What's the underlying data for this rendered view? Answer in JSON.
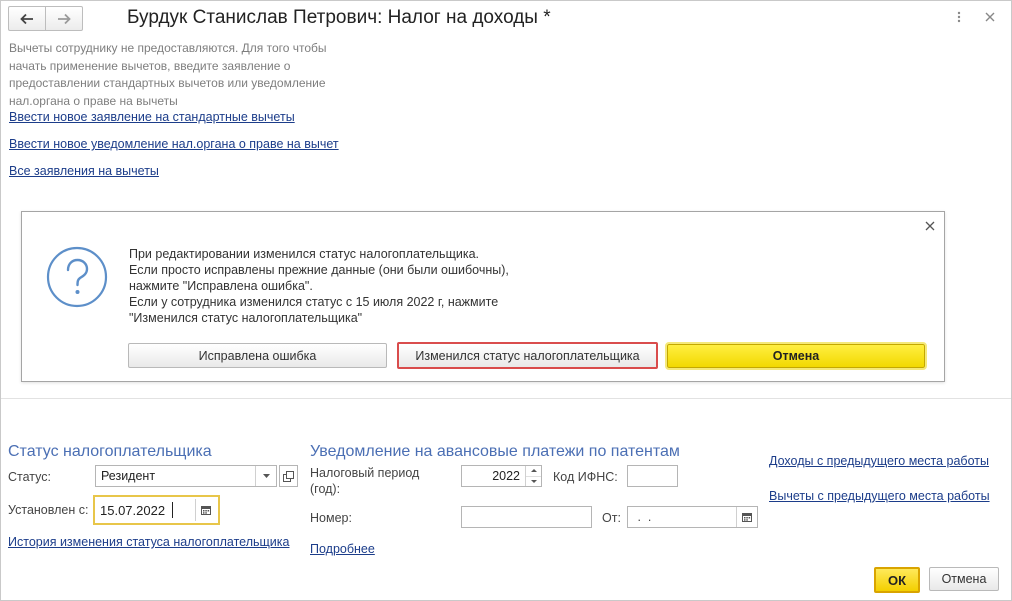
{
  "window": {
    "title": "Бурдук Станислав Петрович: Налог на доходы *",
    "back_icon": "arrow-left-icon",
    "forward_icon": "arrow-right-icon",
    "more_icon": "more-vertical-icon",
    "close_icon": "close-icon"
  },
  "info": {
    "text_lines": [
      "Вычеты сотруднику не предоставляются. Для того чтобы",
      "начать применение вычетов, введите заявление о",
      "предоставлении стандартных вычетов или уведомление",
      "нал.органа о праве на вычеты"
    ],
    "link_standard": "Ввести новое заявление на стандартные вычеты",
    "link_notice": "Ввести новое уведомление нал.органа о праве на вычет",
    "link_all": "Все заявления на вычеты"
  },
  "dialog": {
    "icon": "question-icon",
    "message_lines": [
      "При редактировании изменился статус налогоплательщика.",
      "Если просто исправлены прежние данные (они были ошибочны),",
      "нажмите \"Исправлена ошибка\".",
      "Если у сотрудника изменился статус с 15 июля 2022 г, нажмите",
      "\"Изменился статус налогоплательщика\""
    ],
    "btn_fixed": "Исправлена ошибка",
    "btn_changed": "Изменился статус налогоплательщика",
    "btn_cancel": "Отмена"
  },
  "status_section": {
    "heading": "Статус налогоплательщика",
    "status_label": "Статус:",
    "status_value": "Резидент",
    "set_label": "Установлен с:",
    "set_value": "15.07.2022",
    "history_link": "История изменения статуса налогоплательщика"
  },
  "patent_section": {
    "heading": "Уведомление на авансовые платежи по патентам",
    "period_label_1": "Налоговый период",
    "period_label_2": "(год):",
    "period_value": "2022",
    "ifns_label": "Код ИФНС:",
    "ifns_value": "",
    "number_label": "Номер:",
    "number_value": "",
    "from_label": "От:",
    "from_value": " .  .",
    "details_link": "Подробнее"
  },
  "right_links": {
    "income_prev": "Доходы с предыдущего места работы",
    "deductions_prev": "Вычеты с предыдущего места работы"
  },
  "footer": {
    "ok": "ОК",
    "cancel": "Отмена"
  },
  "colors": {
    "link": "#1c3d8a",
    "section_heading": "#4b6fb4",
    "accent_yellow": "#f3d600",
    "error_red": "#d94c4c",
    "icon_blue": "#5d8fc9"
  }
}
